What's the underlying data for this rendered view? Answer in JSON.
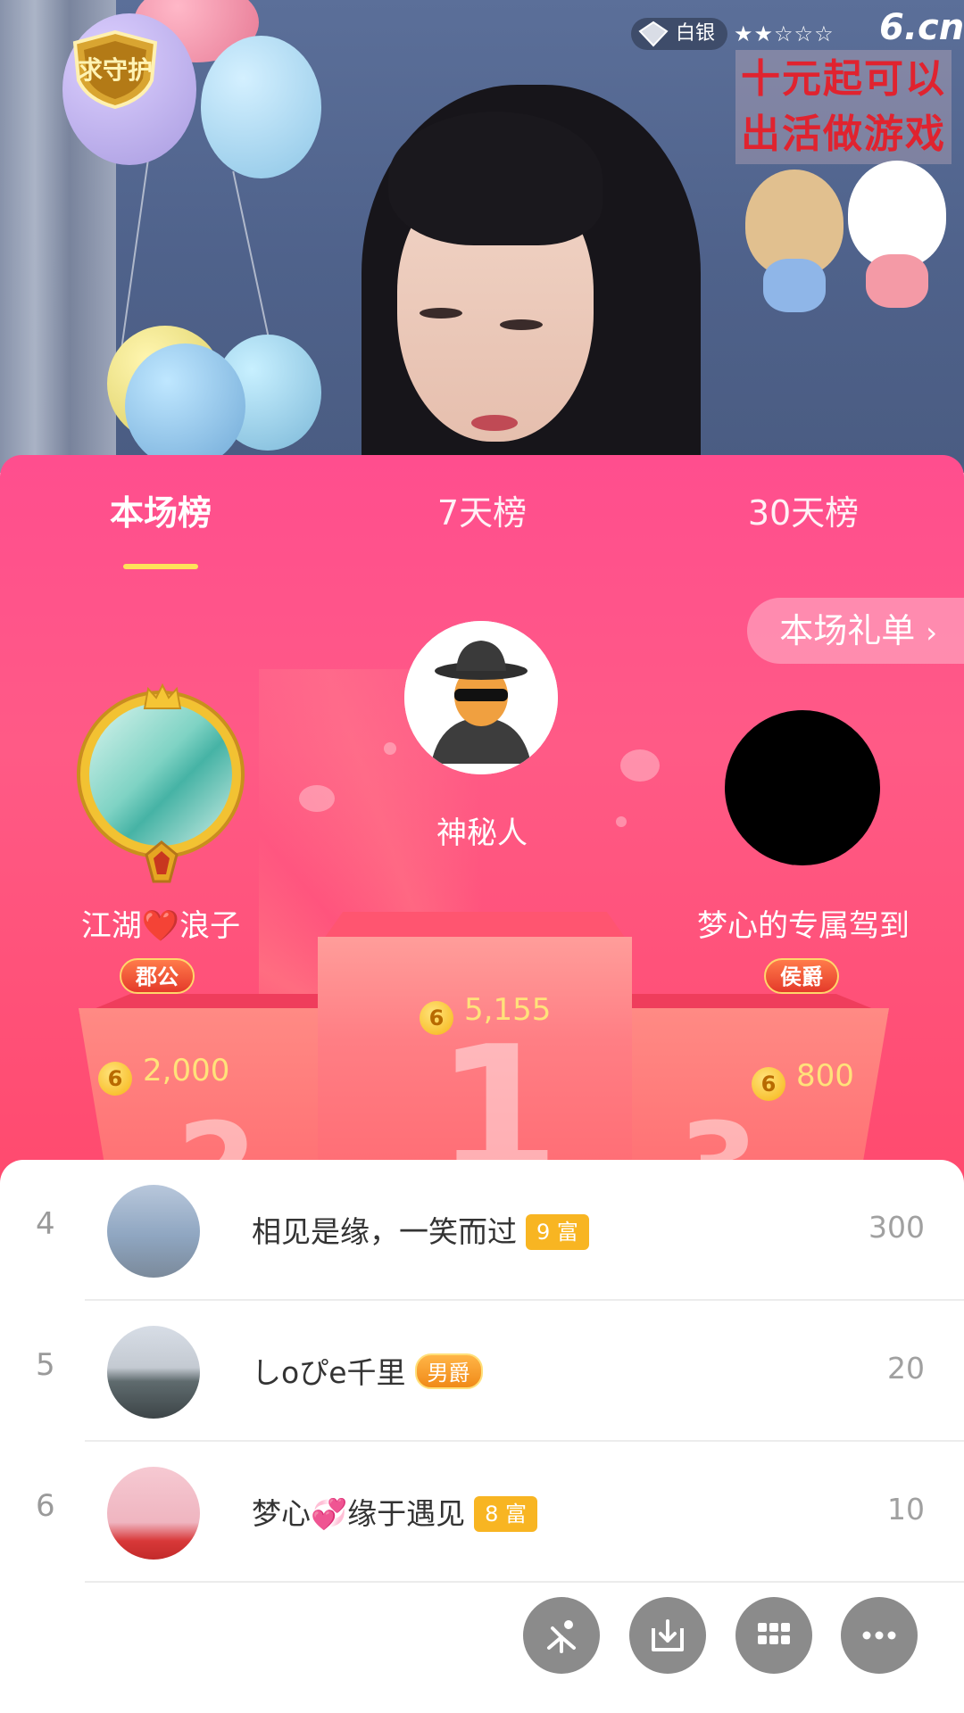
{
  "stream": {
    "level_label": "白银",
    "stars": "★★☆☆☆",
    "logo": "6.cn",
    "sticker_line1": "十元起可以",
    "sticker_line2": "出活做游戏",
    "badge_text": "求守护"
  },
  "tabs": [
    {
      "label": "本场榜",
      "active": true
    },
    {
      "label": "7天榜",
      "active": false
    },
    {
      "label": "30天榜",
      "active": false
    }
  ],
  "gift_list_button": "本场礼单",
  "podium": {
    "first": {
      "rank": "1",
      "name": "神秘人",
      "score": "5,155"
    },
    "second": {
      "rank": "2",
      "name": "江湖❤️浪子",
      "title": "郡公",
      "score": "2,000"
    },
    "third": {
      "rank": "3",
      "name": "梦心的专属驾到",
      "title": "侯爵",
      "score": "800"
    }
  },
  "coin_symbol": "6",
  "list": [
    {
      "rank": "4",
      "name": "相见是缘，一笑而过",
      "badge": "9 富",
      "value": "300"
    },
    {
      "rank": "5",
      "name": "しoぴe千里",
      "badge": "男爵",
      "value": "20"
    },
    {
      "rank": "6",
      "name": "梦心💞缘于遇见",
      "badge": "8 富",
      "value": "10"
    }
  ],
  "toolbar_icons": [
    "sparkle-icon",
    "download-icon",
    "grid-icon",
    "more-icon"
  ],
  "colors": {
    "panel_pink": "#ff5a86",
    "tab_underline": "#ffe25a",
    "coin": "#f6b516",
    "wealth_chip": "#f8b522"
  }
}
